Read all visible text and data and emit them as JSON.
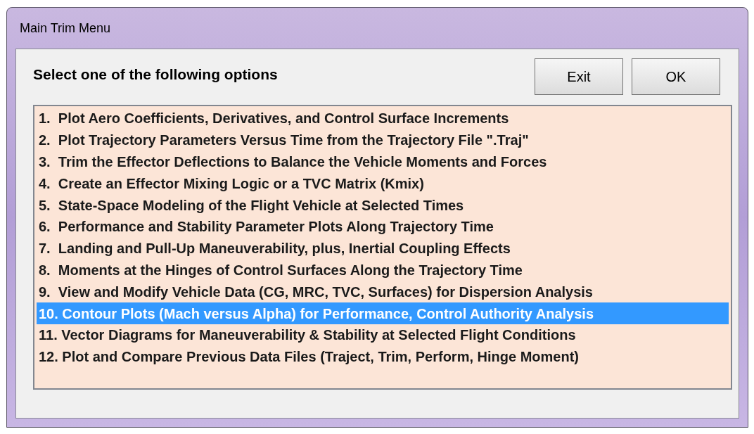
{
  "window": {
    "title": "Main Trim Menu"
  },
  "heading": "Select one of the following options",
  "buttons": [
    {
      "label": "Exit"
    },
    {
      "label": "OK"
    }
  ],
  "options": [
    {
      "label": "1.  Plot Aero Coefficients, Derivatives, and Control Surface Increments",
      "selected": false
    },
    {
      "label": "2.  Plot Trajectory Parameters Versus Time from the Trajectory File \".Traj\"",
      "selected": false
    },
    {
      "label": "3.  Trim the Effector Deflections to Balance the Vehicle Moments and Forces",
      "selected": false
    },
    {
      "label": "4.  Create an Effector Mixing Logic or a TVC Matrix (Kmix)",
      "selected": false
    },
    {
      "label": "5.  State-Space Modeling of the Flight Vehicle at Selected Times",
      "selected": false
    },
    {
      "label": "6.  Performance and Stability Parameter Plots Along Trajectory Time",
      "selected": false
    },
    {
      "label": "7.  Landing and Pull-Up Maneuverability, plus, Inertial Coupling Effects",
      "selected": false
    },
    {
      "label": "8.  Moments at the Hinges of Control Surfaces Along the Trajectory Time",
      "selected": false
    },
    {
      "label": "9.  View and Modify Vehicle Data (CG, MRC, TVC, Surfaces) for Dispersion Analysis",
      "selected": false
    },
    {
      "label": "10. Contour Plots (Mach versus Alpha) for Performance, Control Authority Analysis",
      "selected": true
    },
    {
      "label": "11. Vector Diagrams for Maneuverability & Stability at Selected Flight Conditions",
      "selected": false
    },
    {
      "label": "12. Plot and Compare Previous Data Files (Traject, Trim, Perform, Hinge Moment)",
      "selected": false
    }
  ]
}
